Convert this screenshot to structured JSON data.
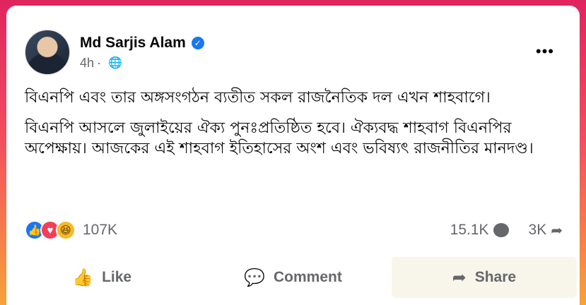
{
  "post": {
    "author": "Md Sarjis Alam",
    "time": "4h",
    "paragraphs": [
      "বিএনপি এবং তার অঙ্গসংগঠন ব্যতীত সকল রাজনৈতিক দল এখন শাহবাগে।",
      "বিএনপি আসলে জুলাইয়ের ঐক্য পুনঃপ্রতিষ্ঠিত হবে। ঐক্যবদ্ধ শাহবাগ বিএনপির অপেক্ষায়। আজকের এই শাহবাগ ইতিহাসের অংশ এবং ভবিষ্যৎ রাজনীতির মানদণ্ড।"
    ]
  },
  "stats": {
    "reactions": "107K",
    "comments": "15.1K",
    "shares": "3K"
  },
  "actions": {
    "like": "Like",
    "comment": "Comment",
    "share": "Share"
  },
  "colors": {
    "accent": "#1877f2",
    "love": "#f33e58",
    "haha": "#f7b928"
  },
  "icons": [
    "verified-icon",
    "globe-icon",
    "more-icon",
    "like-reaction-icon",
    "love-reaction-icon",
    "haha-reaction-icon",
    "comment-icon",
    "share-icon",
    "thumbs-up-icon"
  ]
}
